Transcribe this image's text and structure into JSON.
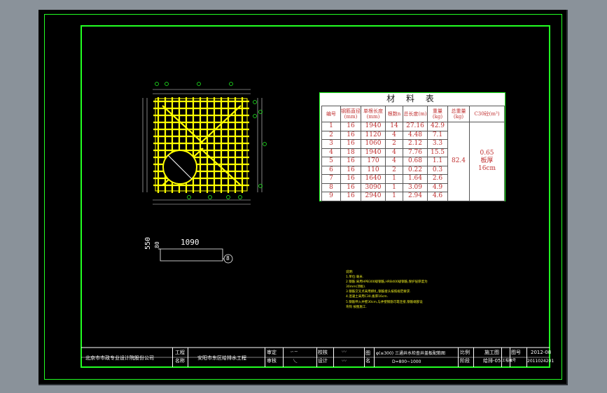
{
  "rebar_plan": {
    "bar_label": "1090",
    "bar_dim_a": "550",
    "bar_dim_b": "80",
    "bar_mark": "8"
  },
  "material_table": {
    "title": "材 料 表",
    "headers": [
      "编号",
      "钢筋直径(mm)",
      "单根长度(mm)",
      "根数n",
      "总长度(m)",
      "重量(kg)",
      "总重量(kg)",
      "C30砼(m³)"
    ],
    "rows": [
      [
        "1",
        "16",
        "1940",
        "14",
        "27.16",
        "42.9"
      ],
      [
        "2",
        "16",
        "1120",
        "4",
        "4.48",
        "7.1"
      ],
      [
        "3",
        "16",
        "1060",
        "2",
        "2.12",
        "3.3"
      ],
      [
        "4",
        "18",
        "1940",
        "4",
        "7.76",
        "15.5"
      ],
      [
        "5",
        "16",
        "170",
        "4",
        "0.68",
        "1.1"
      ],
      [
        "6",
        "16",
        "110",
        "2",
        "0.22",
        "0.3"
      ],
      [
        "7",
        "16",
        "1640",
        "1",
        "1.64",
        "2.6"
      ],
      [
        "8",
        "16",
        "3090",
        "1",
        "3.09",
        "4.9"
      ],
      [
        "9",
        "16",
        "2940",
        "1",
        "2.94",
        "4.6"
      ]
    ],
    "total_weight": "82.4",
    "concrete": "0.65",
    "concrete_note1": "板厚",
    "concrete_note2": "16cm"
  },
  "notes": {
    "heading": "说明:",
    "lines": [
      "1.单位:毫米.",
      "2.钢筋:采用HPB300级钢筋,HRB400级钢筋,保护层厚度为",
      "  30mm(顶板).",
      "3.钢筋交叉点采用绑扎,钢筋接头按照规范要求.",
      "4.混凝土采用C30,板厚16cm.",
      "5.钢筋伸入井壁30cm,与井壁钢筋可靠连接,钢筋端部设",
      "  弯钩 按图施工."
    ]
  },
  "title_block": {
    "company": "北京市市政专业设计院股份公司",
    "project_label1": "工程",
    "project_label2": "名称",
    "project": "安阳市东区给排水工程",
    "review1": "审定",
    "review2": "审核",
    "check1": "校核",
    "check2": "设计",
    "drawing_label": "图名",
    "drawing_name1": "φ(≤300) 三通井水检查井盖板配筋图",
    "drawing_name2": "D=800~1000",
    "scale_label": "比例",
    "stage_label": "阶段",
    "stage": "施工图",
    "sheet_label": "图号",
    "sheet": "给排-05",
    "date_label": "日期",
    "date": "2012-08",
    "project_no_label": "工程编号",
    "project_no": "2011024201"
  }
}
